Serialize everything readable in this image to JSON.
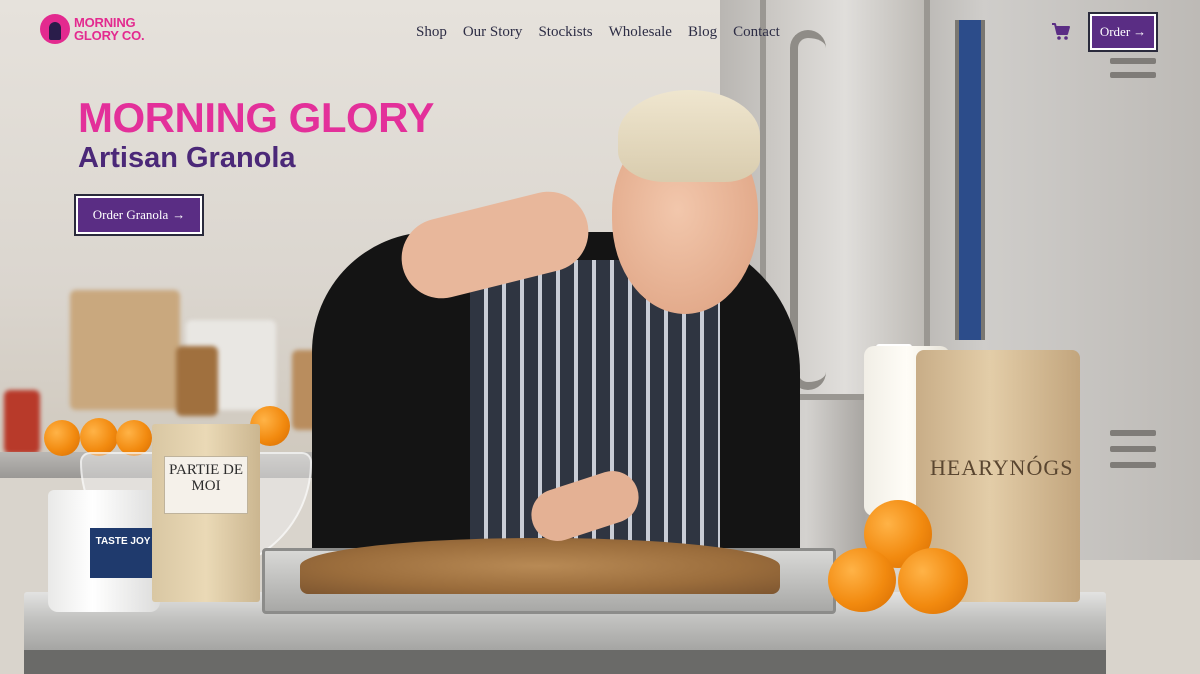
{
  "brand": {
    "line1": "MORNING",
    "line2": "GLORY CO.",
    "color": "#e32a8f"
  },
  "nav": {
    "items": [
      {
        "label": "Shop"
      },
      {
        "label": "Our Story"
      },
      {
        "label": "Stockists"
      },
      {
        "label": "Wholesale"
      },
      {
        "label": "Blog"
      },
      {
        "label": "Contact"
      }
    ]
  },
  "header": {
    "cart_icon": "shopping-cart-icon",
    "order_label": "Order",
    "order_arrow": "→"
  },
  "hero": {
    "title": "MORNING GLORY",
    "subtitle": "Artisan Granola",
    "cta_label": "Order Granola",
    "cta_arrow": "→",
    "image_alt_products": {
      "bag_left": "PARTIE DE MOI",
      "bag_right": "HEARYNÓGS",
      "bucket": "TASTE JOY"
    }
  },
  "colors": {
    "accent_pink": "#e3309a",
    "accent_purple": "#5a2d84",
    "nav_text": "#2d2d45"
  }
}
